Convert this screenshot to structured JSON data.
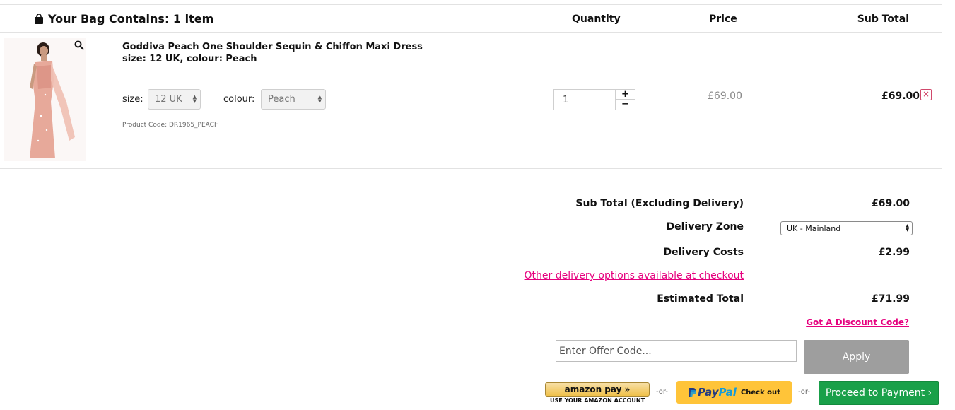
{
  "header": {
    "title": "Your Bag Contains: 1 item",
    "columns": {
      "quantity": "Quantity",
      "price": "Price",
      "subtotal": "Sub Total"
    }
  },
  "item": {
    "name": "Goddiva Peach One Shoulder Sequin & Chiffon Maxi Dress",
    "meta": "size: 12 UK, colour: Peach",
    "size_label": "size:",
    "size_value": "12 UK",
    "colour_label": "colour:",
    "colour_value": "Peach",
    "product_code": "Product Code: DR1965_PEACH",
    "quantity": "1",
    "qty_plus": "+",
    "qty_minus": "−",
    "price": "£69.00",
    "subtotal": "£69.00",
    "remove_glyph": "×"
  },
  "totals": {
    "subtotal_label": "Sub Total (Excluding Delivery)",
    "subtotal_value": "£69.00",
    "zone_label": "Delivery Zone",
    "zone_value": "UK - Mainland",
    "delivery_label": "Delivery Costs",
    "delivery_value": "£2.99",
    "delivery_link": "Other delivery options available at checkout",
    "estimated_label": "Estimated Total",
    "estimated_value": "£71.99",
    "discount_link": "Got A Discount Code?",
    "offer_placeholder": "Enter Offer Code...",
    "apply_label": "Apply"
  },
  "payment": {
    "amazon_label": "amazon pay »",
    "amazon_caption": "USE YOUR AMAZON ACCOUNT",
    "or_text": "-or-",
    "paypal_pay": "Pay",
    "paypal_pal": "Pal",
    "paypal_cta": "Check out",
    "proceed_label": "Proceed to Payment ›"
  },
  "colors": {
    "accent_pink": "#e6007e",
    "proceed_green": "#19a049",
    "paypal_yellow": "#ffc439",
    "apply_grey": "#9e9e9e"
  }
}
